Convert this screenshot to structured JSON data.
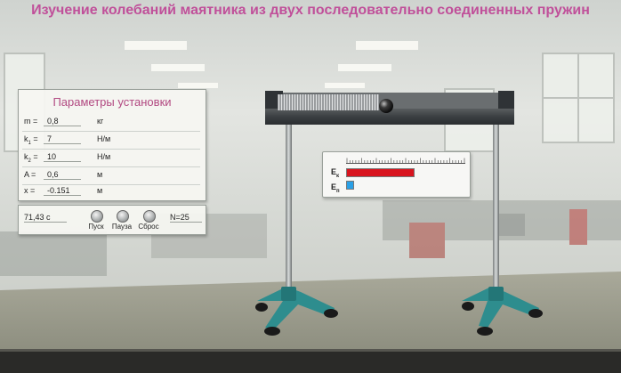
{
  "page_title": "Изучение колебаний маятника из двух последовательно соединенных пружин",
  "parameters_panel": {
    "title": "Параметры установки",
    "rows": [
      {
        "label": "m =",
        "value": "0,8",
        "unit": "кг",
        "editable": true
      },
      {
        "label": "k",
        "label_sub": "1",
        "label_eq": " =",
        "value": "7",
        "unit": "Н/м",
        "editable": true
      },
      {
        "label": "k",
        "label_sub": "2",
        "label_eq": " =",
        "value": "10",
        "unit": "Н/м",
        "editable": true
      },
      {
        "label": "A =",
        "value": "0,6",
        "unit": "м",
        "editable": true
      },
      {
        "label": "x =",
        "value": "-0.151",
        "unit": "м",
        "editable": false
      }
    ]
  },
  "controls": {
    "time": "71,43 с",
    "start_label": "Пуск",
    "pause_label": "Пауза",
    "reset_label": "Сброс",
    "count": "N=25"
  },
  "energy_panel": {
    "kinetic": {
      "label": "E",
      "sub": "к",
      "fraction": 0.56,
      "color": "#d8141e"
    },
    "potential": {
      "label": "E",
      "sub": "п",
      "fraction": 0.05,
      "color": "#2aa0e6"
    }
  },
  "colors": {
    "title": "#c0509a",
    "panel_title": "#b24a82",
    "stand": "#2b8a8a"
  }
}
